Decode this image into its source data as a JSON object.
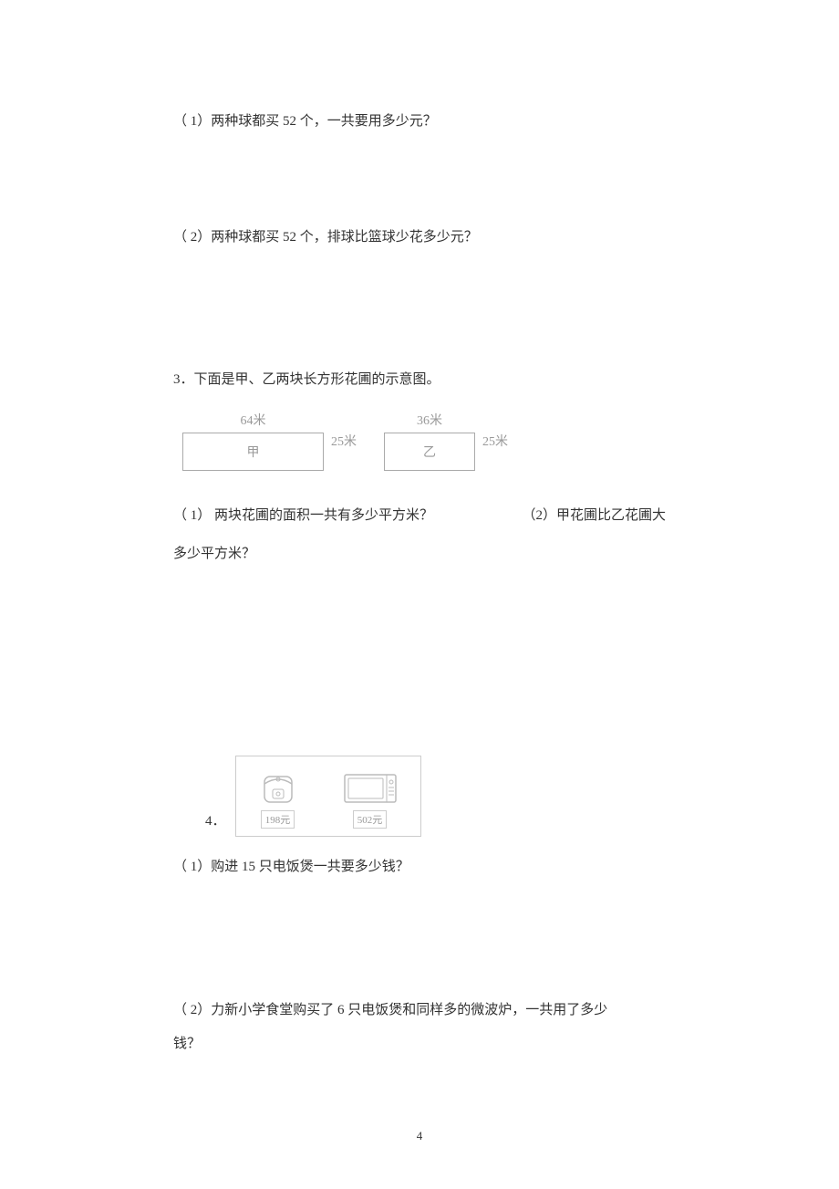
{
  "q2_1": "（ 1）两种球都买 52 个，一共要用多少元？",
  "q2_2": "（ 2）两种球都买 52 个，排球比篮球少花多少元？",
  "q3_title": "3．下面是甲、乙两块长方形花圃的示意图。",
  "q3_rect1_top": "64米",
  "q3_rect1_name": "甲",
  "q3_rect1_side": "25米",
  "q3_rect2_top": "36米",
  "q3_rect2_name": "乙",
  "q3_rect2_side": "25米",
  "q3_sub1": "（ 1） 两块花圃的面积一共有多少平方米？",
  "q3_sub2a": "（2）甲花圃比乙花圃大",
  "q3_sub2b": "多少平方米？",
  "q4_number": "4．",
  "q4_price1": "198元",
  "q4_price2": "502元",
  "q4_sub1": "（ 1）购进 15 只电饭煲一共要多少钱？",
  "q4_sub2a": "（ 2）力新小学食堂购买了 6 只电饭煲和同样多的微波炉，一共用了多少",
  "q4_sub2b": "钱？",
  "page_number": "4"
}
